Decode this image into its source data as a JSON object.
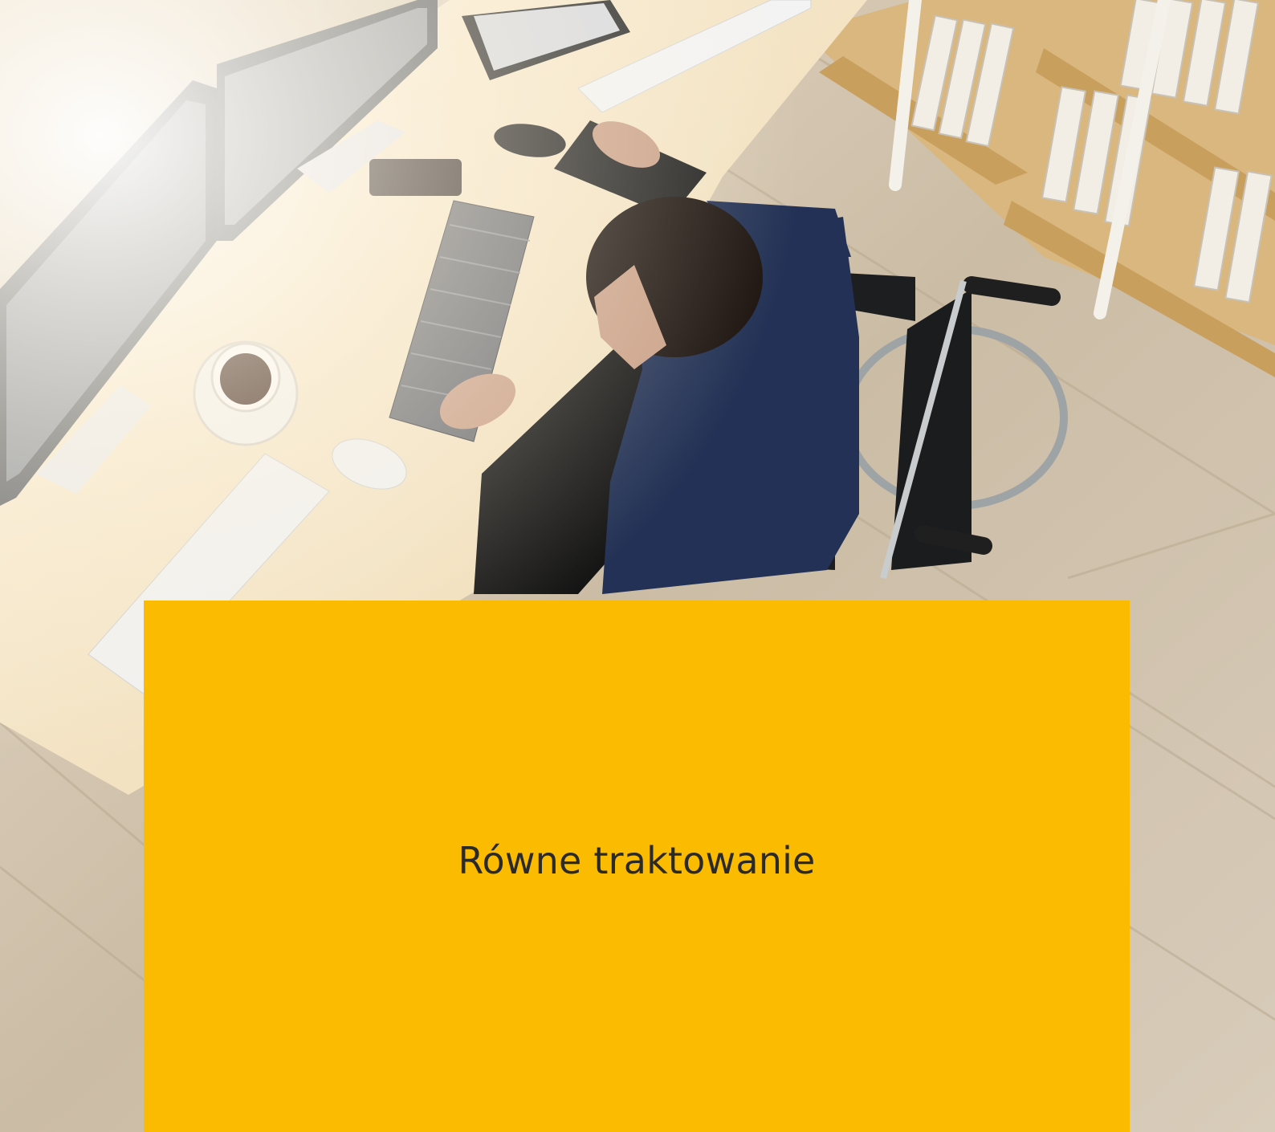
{
  "colors": {
    "card_background": "#fabb00",
    "title_text": "#2a2a2a"
  },
  "hero": {
    "image": "photo-man-in-wheelchair-working-at-desk"
  },
  "card": {
    "title": "Równe traktowanie"
  }
}
